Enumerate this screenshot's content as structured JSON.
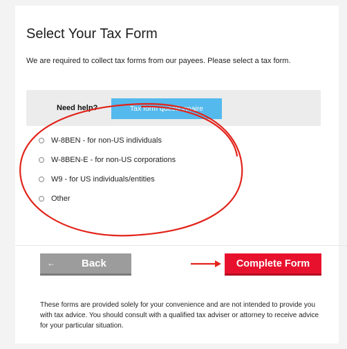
{
  "header": {
    "title": "Select Your Tax Form",
    "intro": "We are required to collect tax forms from our payees. Please select a tax form."
  },
  "help": {
    "label": "Need help?",
    "button_label": "Tax form questionnaire"
  },
  "options": [
    {
      "label": "W-8BEN - for non-US individuals",
      "selected": false
    },
    {
      "label": "W-8BEN-E - for non-US corporations",
      "selected": false
    },
    {
      "label": "W9 - for US individuals/entities",
      "selected": false
    },
    {
      "label": "Other",
      "selected": false
    }
  ],
  "actions": {
    "back_label": "Back",
    "back_icon": "arrow-left-icon",
    "complete_label": "Complete Form"
  },
  "footer": {
    "disclaimer": "These forms are provided solely for your convenience and are not intended to provide you with tax advice. You should consult with a qualified tax adviser or attorney to receive advice for your particular situation."
  },
  "annotation": {
    "color": "#e2231a",
    "circle_shape": "hand-drawn-ellipse",
    "arrow_shape": "right-arrow"
  },
  "colors": {
    "help_button": "#54b9ec",
    "complete_button": "#e8112d",
    "back_button": "#9c9c9c"
  }
}
